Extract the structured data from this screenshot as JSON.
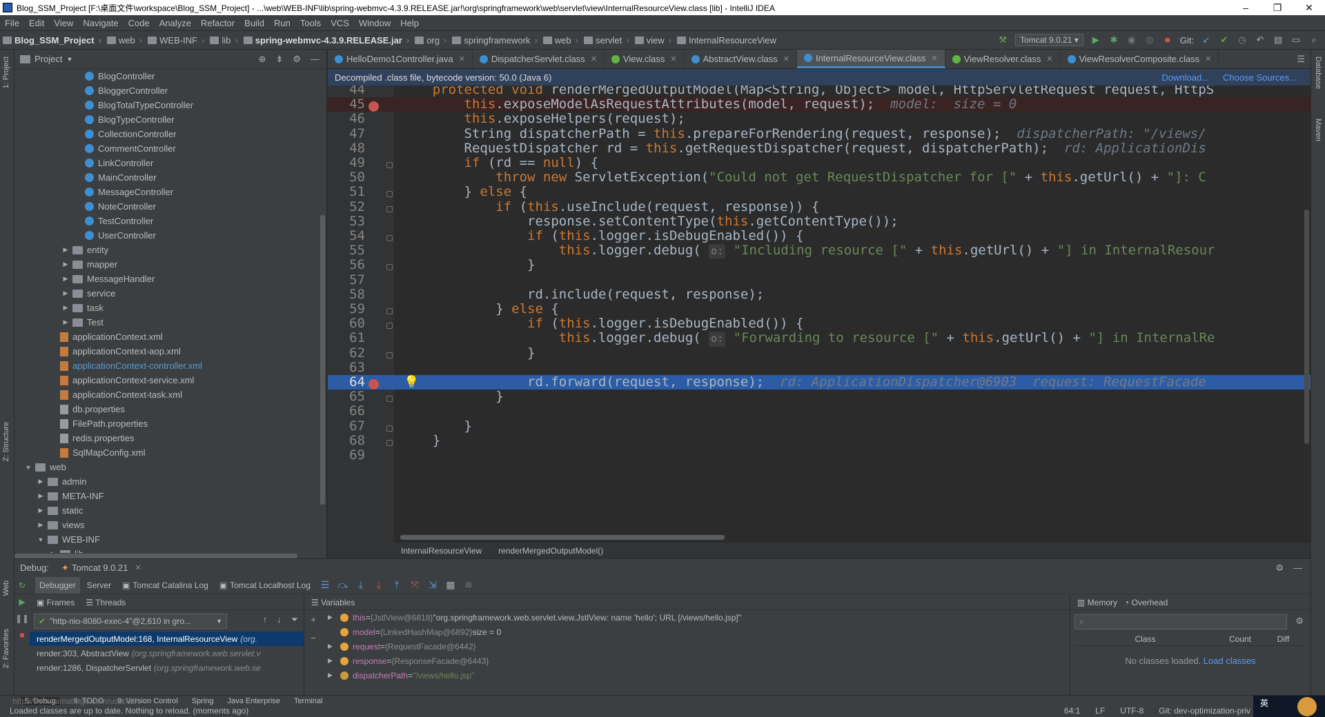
{
  "window": {
    "title": "Blog_SSM_Project [F:\\桌面文件\\workspace\\Blog_SSM_Project] - ...\\web\\WEB-INF\\lib\\spring-webmvc-4.3.9.RELEASE.jar!\\org\\springframework\\web\\servlet\\view\\InternalResourceView.class [lib] - IntelliJ IDEA",
    "minimize": "–",
    "maximize": "❐",
    "close": "✕"
  },
  "menu": [
    "File",
    "Edit",
    "View",
    "Navigate",
    "Code",
    "Analyze",
    "Refactor",
    "Build",
    "Run",
    "Tools",
    "VCS",
    "Window",
    "Help"
  ],
  "breadcrumbs": [
    "Blog_SSM_Project",
    "web",
    "WEB-INF",
    "lib",
    "spring-webmvc-4.3.9.RELEASE.jar",
    "org",
    "springframework",
    "web",
    "servlet",
    "view",
    "InternalResourceView"
  ],
  "toolbar": {
    "run_config": "Tomcat 9.0.21",
    "git_label": "Git:"
  },
  "project": {
    "title": "Project",
    "tree": [
      {
        "indent": 4,
        "icon": "class",
        "label": "BlogController"
      },
      {
        "indent": 4,
        "icon": "class",
        "label": "BloggerController"
      },
      {
        "indent": 4,
        "icon": "class",
        "label": "BlogTotalTypeController"
      },
      {
        "indent": 4,
        "icon": "class",
        "label": "BlogTypeController"
      },
      {
        "indent": 4,
        "icon": "class",
        "label": "CollectionController"
      },
      {
        "indent": 4,
        "icon": "class",
        "label": "CommentController"
      },
      {
        "indent": 4,
        "icon": "class",
        "label": "LinkController"
      },
      {
        "indent": 4,
        "icon": "class",
        "label": "MainController"
      },
      {
        "indent": 4,
        "icon": "class",
        "label": "MessageController"
      },
      {
        "indent": 4,
        "icon": "class",
        "label": "NoteController"
      },
      {
        "indent": 4,
        "icon": "class",
        "label": "TestController"
      },
      {
        "indent": 4,
        "icon": "class",
        "label": "UserController"
      },
      {
        "indent": 3,
        "icon": "folder",
        "arrow": "▶",
        "label": "entity"
      },
      {
        "indent": 3,
        "icon": "folder",
        "arrow": "▶",
        "label": "mapper"
      },
      {
        "indent": 3,
        "icon": "folder",
        "arrow": "▶",
        "label": "MessageHandler"
      },
      {
        "indent": 3,
        "icon": "folder",
        "arrow": "▶",
        "label": "service"
      },
      {
        "indent": 3,
        "icon": "folder",
        "arrow": "▶",
        "label": "task"
      },
      {
        "indent": 3,
        "icon": "folder",
        "arrow": "▶",
        "label": "Test"
      },
      {
        "indent": 2,
        "icon": "xml",
        "label": "applicationContext.xml"
      },
      {
        "indent": 2,
        "icon": "xml",
        "label": "applicationContext-aop.xml"
      },
      {
        "indent": 2,
        "icon": "xml",
        "label": "applicationContext-controller.xml",
        "highlight": true
      },
      {
        "indent": 2,
        "icon": "xml",
        "label": "applicationContext-service.xml"
      },
      {
        "indent": 2,
        "icon": "xml",
        "label": "applicationContext-task.xml"
      },
      {
        "indent": 2,
        "icon": "props",
        "label": "db.properties"
      },
      {
        "indent": 2,
        "icon": "props",
        "label": "FilePath.properties"
      },
      {
        "indent": 2,
        "icon": "props",
        "label": "redis.properties"
      },
      {
        "indent": 2,
        "icon": "xml",
        "label": "SqlMapConfig.xml"
      },
      {
        "indent": 0,
        "icon": "folder",
        "arrow": "▼",
        "label": "web"
      },
      {
        "indent": 1,
        "icon": "folder",
        "arrow": "▶",
        "label": "admin"
      },
      {
        "indent": 1,
        "icon": "folder",
        "arrow": "▶",
        "label": "META-INF"
      },
      {
        "indent": 1,
        "icon": "folder",
        "arrow": "▶",
        "label": "static"
      },
      {
        "indent": 1,
        "icon": "folder",
        "arrow": "▶",
        "label": "views"
      },
      {
        "indent": 1,
        "icon": "folder",
        "arrow": "▼",
        "label": "WEB-INF"
      },
      {
        "indent": 2,
        "icon": "folder",
        "arrow": "▶",
        "label": "lib"
      }
    ]
  },
  "tabs": [
    {
      "label": "HelloDemo1Controller.java",
      "color": "#3d8fd1"
    },
    {
      "label": "DispatcherServlet.class",
      "color": "#3d8fd1"
    },
    {
      "label": "View.class",
      "color": "#62b543"
    },
    {
      "label": "AbstractView.class",
      "color": "#3d8fd1"
    },
    {
      "label": "InternalResourceView.class",
      "color": "#3d8fd1",
      "active": true
    },
    {
      "label": "ViewResolver.class",
      "color": "#62b543"
    },
    {
      "label": "ViewResolverComposite.class",
      "color": "#3d8fd1"
    }
  ],
  "banner": {
    "text": "Decompiled .class file, bytecode version: 50.0 (Java 6)",
    "download": "Download...",
    "choose_sources": "Choose Sources..."
  },
  "code": [
    {
      "n": "44",
      "html": "    <span class=\"kw\">protected void</span> renderMergedOutputModel(Map&lt;String, Object&gt; model, HttpServletRequest request, HttpS"
    },
    {
      "n": "45",
      "bp": true,
      "cls": "bpline",
      "html": "        <span class=\"kw\">this</span>.exposeModelAsRequestAttributes(model, request);  <span class=\"hint\">model:  size = 0</span>"
    },
    {
      "n": "46",
      "html": "        <span class=\"kw\">this</span>.exposeHelpers(request);"
    },
    {
      "n": "47",
      "html": "        String dispatcherPath = <span class=\"kw\">this</span>.prepareForRendering(request, response);  <span class=\"hint\">dispatcherPath: \"/views/</span>"
    },
    {
      "n": "48",
      "html": "        RequestDispatcher rd = <span class=\"kw\">this</span>.getRequestDispatcher(request, dispatcherPath);  <span class=\"hint\">rd: ApplicationDis</span>"
    },
    {
      "n": "49",
      "fold": true,
      "html": "        <span class=\"kw\">if</span> (rd == <span class=\"kw\">null</span>) {"
    },
    {
      "n": "50",
      "html": "            <span class=\"kw\">throw new</span> ServletException(<span class=\"str\">\"Could not get RequestDispatcher for [\"</span> + <span class=\"kw\">this</span>.getUrl() + <span class=\"str\">\"]: C</span>"
    },
    {
      "n": "51",
      "fold": true,
      "html": "        } <span class=\"kw\">else</span> {"
    },
    {
      "n": "52",
      "fold": true,
      "html": "            <span class=\"kw\">if</span> (<span class=\"kw\">this</span>.useInclude(request, response)) {"
    },
    {
      "n": "53",
      "html": "                response.setContentType(<span class=\"kw\">this</span>.getContentType());"
    },
    {
      "n": "54",
      "fold": true,
      "html": "                <span class=\"kw\">if</span> (<span class=\"kw\">this</span>.logger.isDebugEnabled()) {"
    },
    {
      "n": "55",
      "html": "                    <span class=\"kw\">this</span>.logger.debug( <span class=\"param-hint\">o:</span> <span class=\"str\">\"Including resource [\"</span> + <span class=\"kw\">this</span>.getUrl() + <span class=\"str\">\"] in InternalResour</span>"
    },
    {
      "n": "56",
      "fold": true,
      "html": "                }"
    },
    {
      "n": "57",
      "html": ""
    },
    {
      "n": "58",
      "html": "                rd.include(request, response);"
    },
    {
      "n": "59",
      "fold": true,
      "html": "            } <span class=\"kw\">else</span> {"
    },
    {
      "n": "60",
      "fold": true,
      "html": "                <span class=\"kw\">if</span> (<span class=\"kw\">this</span>.logger.isDebugEnabled()) {"
    },
    {
      "n": "61",
      "html": "                    <span class=\"kw\">this</span>.logger.debug( <span class=\"param-hint\">o:</span> <span class=\"str\">\"Forwarding to resource [\"</span> + <span class=\"kw\">this</span>.getUrl() + <span class=\"str\">\"] in InternalRe</span>"
    },
    {
      "n": "62",
      "fold": true,
      "html": "                }"
    },
    {
      "n": "63",
      "html": ""
    },
    {
      "n": "64",
      "bp": true,
      "bulb": true,
      "cls": "exec",
      "html": "                rd.forward(request, response);  <span class=\"hint\">rd: ApplicationDispatcher@6903  request: RequestFacade</span>"
    },
    {
      "n": "65",
      "fold": true,
      "html": "            }"
    },
    {
      "n": "66",
      "html": ""
    },
    {
      "n": "67",
      "fold": true,
      "html": "        }"
    },
    {
      "n": "68",
      "fold": true,
      "html": "    }"
    },
    {
      "n": "69",
      "html": ""
    }
  ],
  "editor_crumbs": [
    "InternalResourceView",
    "renderMergedOutputModel()"
  ],
  "debug": {
    "label": "Debug:",
    "session": "Tomcat 9.0.21",
    "tabs": [
      "Debugger",
      "Server",
      "Tomcat Catalina Log",
      "Tomcat Localhost Log"
    ],
    "frames_label": "Frames",
    "threads_label": "Threads",
    "thread": "\"http-nio-8080-exec-4\"@2,610 in gro...",
    "frames": [
      {
        "method": "renderMergedOutputModel:168, InternalResourceView",
        "pkg": "(org.",
        "selected": true
      },
      {
        "method": "render:303, AbstractView",
        "pkg": "(org.springframework.web.servlet.v"
      },
      {
        "method": "render:1286, DispatcherServlet",
        "pkg": "(org.springframework.web.se"
      }
    ],
    "variables_label": "Variables",
    "variables": [
      {
        "arrow": "▶",
        "color": "#e8a33d",
        "name": "this",
        "type": "{JstlView@6818}",
        "value": "\"org.springframework.web.servlet.view.JstlView: name 'hello'; URL [/views/hello.jsp]\""
      },
      {
        "arrow": "",
        "color": "#e8a33d",
        "name": "model",
        "type": "{LinkedHashMap@6892}",
        "value": "size = 0"
      },
      {
        "arrow": "▶",
        "color": "#e8a33d",
        "name": "request",
        "type": "{RequestFacade@6442}",
        "value": ""
      },
      {
        "arrow": "▶",
        "color": "#e8a33d",
        "name": "response",
        "type": "{ResponseFacade@6443}",
        "value": ""
      },
      {
        "arrow": "▶",
        "color": "#c79d3a",
        "name": "dispatcherPath",
        "type": "",
        "value": "\"/views/hello.jsp\""
      }
    ],
    "memory_label": "Memory",
    "overhead_label": "Overhead",
    "mem_cols": [
      "Class",
      "Count",
      "Diff"
    ],
    "mem_empty": "No classes loaded.",
    "mem_load": "Load classes"
  },
  "tool_tabs": [
    "5: Debug",
    "6: TODO",
    "9: Version Control",
    "Spring",
    "Java Enterprise",
    "Terminal"
  ],
  "side_tabs_left": [
    "1: Project",
    "Z: Structure",
    "Web",
    "2: Favorites"
  ],
  "side_tabs_right": [
    "Database",
    "Maven"
  ],
  "status": {
    "message": "Loaded classes are up to date. Nothing to reload. (moments ago)",
    "watermark": "http://www.aimaboge.com/user/29",
    "position": "64:1",
    "line_sep": "LF",
    "encoding": "UTF-8",
    "git": "Git: dev-optimization-priv"
  },
  "ime": "英"
}
